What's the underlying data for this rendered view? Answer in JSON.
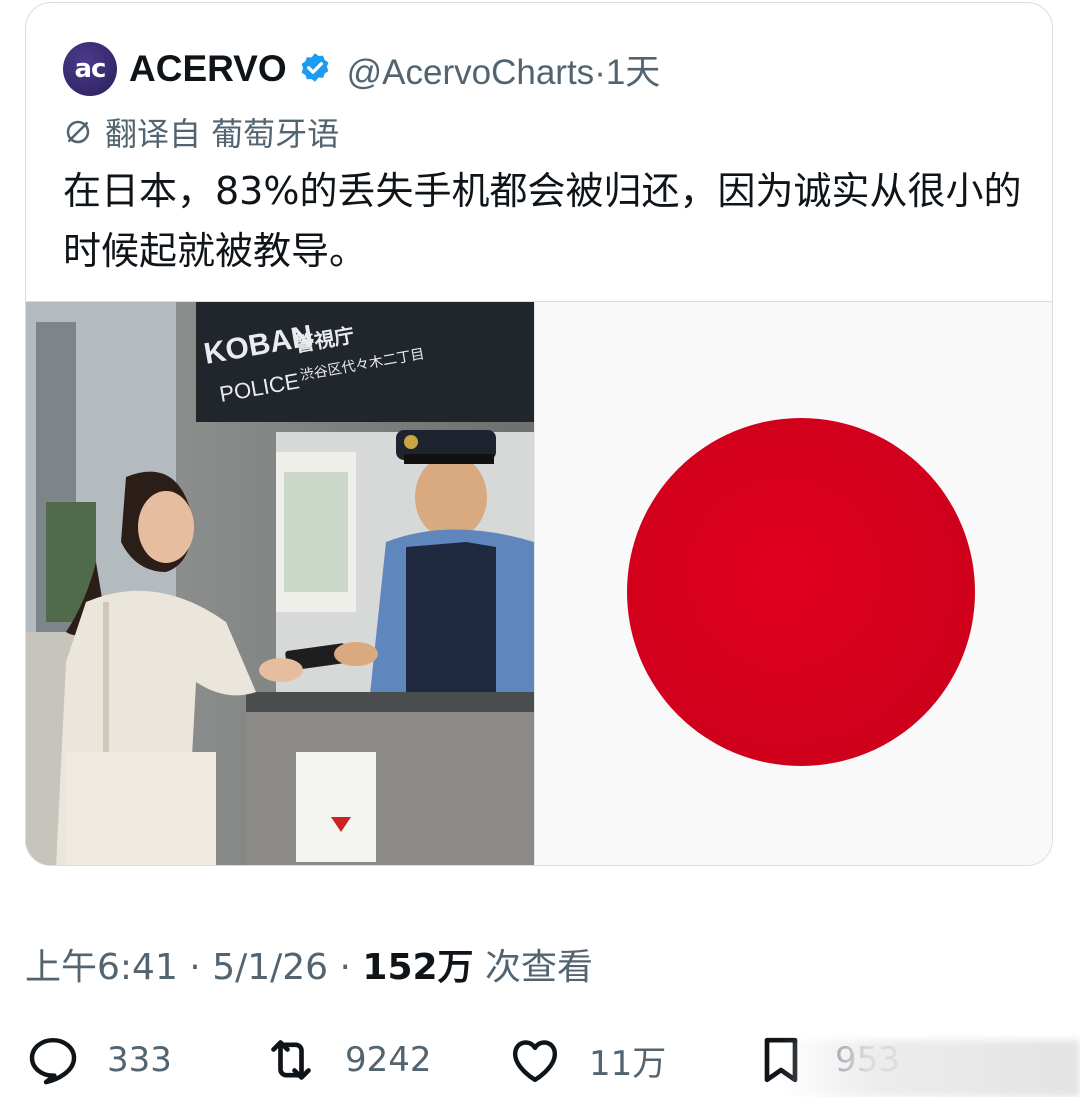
{
  "author": {
    "avatar_text": "ac",
    "display_name": "ACERVO",
    "handle": "@AcervoCharts",
    "separator": "·",
    "time_ago": "1天"
  },
  "translation_note": "翻译自 葡萄牙语",
  "tweet_text": "在日本，83%的丢失手机都会被归还，因为诚实从很小的时候起就被教导。",
  "media": {
    "sign_koban": "KOBAN",
    "sign_police": "POLICE",
    "sign_kanji": "警視庁",
    "sign_address": "渋谷区代々木二丁目"
  },
  "meta": {
    "time": "上午6:41",
    "sep1": " · ",
    "date": "5/1/26",
    "sep2": " · ",
    "views_count": "152万",
    "views_label": " 次查看"
  },
  "actions": {
    "replies": "333",
    "retweets": "9242",
    "likes": "11万",
    "bookmarks": "953"
  },
  "colors": {
    "flag_red": "#c8001a",
    "verified_blue": "#1d9bf0",
    "muted_text": "#536471"
  },
  "icons": [
    "verified-badge-icon",
    "translate-icon",
    "reply-icon",
    "retweet-icon",
    "like-icon",
    "bookmark-icon"
  ]
}
